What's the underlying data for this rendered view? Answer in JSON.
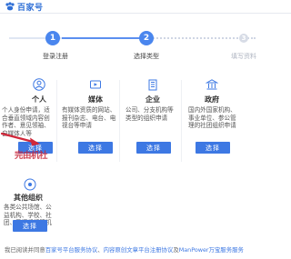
{
  "header": {
    "brand": "百家号",
    "logo_icon": "paw-logo-icon",
    "accent": "#2f6fd6"
  },
  "steps": [
    {
      "number": "1",
      "label": "登录注册",
      "state": "active"
    },
    {
      "number": "2",
      "label": "选择类型",
      "state": "active"
    },
    {
      "number": "3",
      "label": "填写资料",
      "state": "inactive"
    }
  ],
  "types": [
    {
      "title": "个人",
      "icon": "person-icon",
      "desc": "个人身份申请，适合垂直领域内容创作者、意见领袖、自媒体人等",
      "button": "选择"
    },
    {
      "title": "媒体",
      "icon": "media-icon",
      "desc": "有媒体资质的网站、报刊杂志、电台、电视台等申请",
      "button": "选择"
    },
    {
      "title": "企业",
      "icon": "enterprise-icon",
      "desc": "公司、分支机构等类型的组织申请",
      "button": "选择"
    },
    {
      "title": "政府",
      "icon": "government-icon",
      "desc": "国内外国家机构、事业单位、参公管理的社团组织申请",
      "button": "选择"
    },
    {
      "title": "其他组织",
      "icon": "organization-icon",
      "desc": "各类公共场馆、公益机构、学校、社团、民间组织等机构团体申请",
      "button": "选择"
    }
  ],
  "watermark": "完由机社",
  "footer": {
    "prefix": "我已阅读并同意",
    "link1": "百家号平台服务协议",
    "mid1": "、",
    "link2": "内容原创文章平台注册协议",
    "mid2": "及",
    "link3": "ManPower万宝服务服务"
  },
  "colors": {
    "button": "#3d78e3",
    "stamp": "#c8283a",
    "arrow": "#d0283a"
  }
}
